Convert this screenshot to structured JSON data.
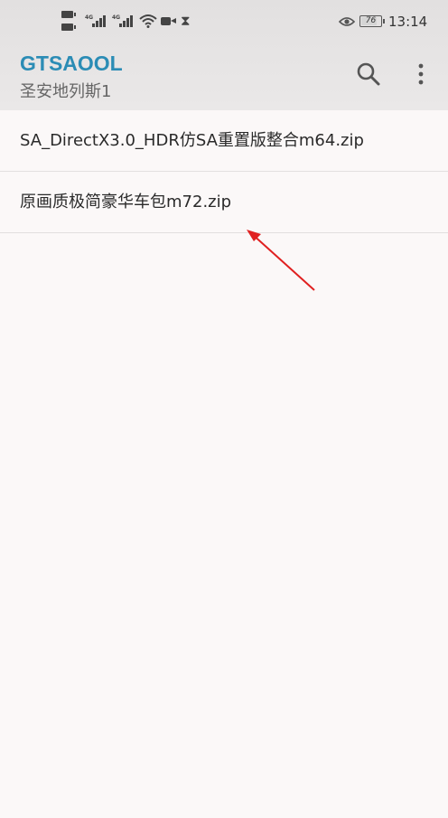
{
  "status_bar": {
    "signal_1": "4G",
    "signal_2": "4G",
    "battery_level": "76",
    "time": "13:14",
    "icons": [
      "sim-icon",
      "signal-icon",
      "wifi-icon",
      "camera-icon",
      "hourglass-icon",
      "eye-icon",
      "battery-icon"
    ]
  },
  "app_bar": {
    "title": "GTSAOOL",
    "subtitle": "圣安地列斯1",
    "title_color": "#2b8cb5",
    "actions": [
      "search-icon",
      "more-vert-icon"
    ]
  },
  "files": [
    {
      "name": "SA_DirectX3.0_HDR仿SA重置版整合m64.zip"
    },
    {
      "name": "原画质极简豪华车包m72.zip"
    }
  ],
  "annotation": {
    "color": "#e02020",
    "icon": "red-arrow-icon"
  }
}
